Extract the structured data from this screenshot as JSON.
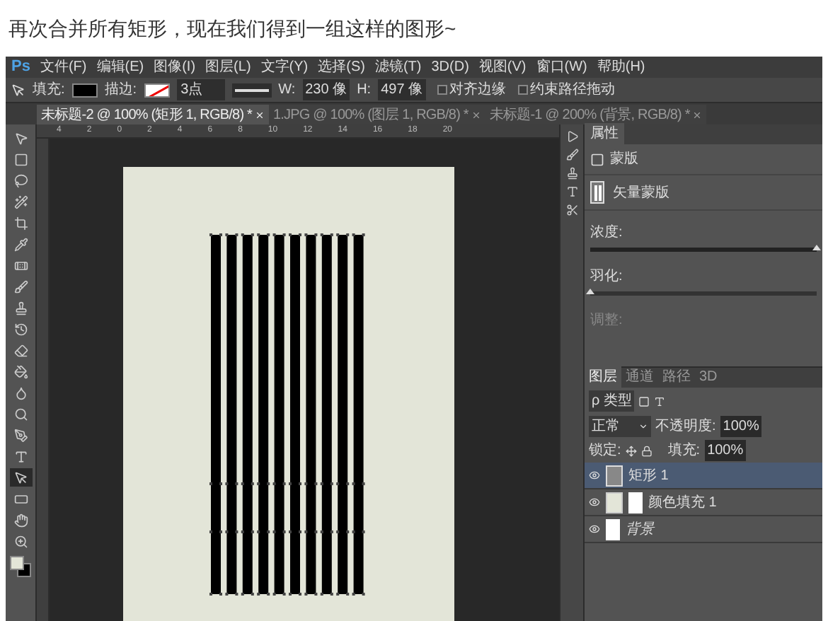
{
  "caption": "再次合并所有矩形，现在我们得到一组这样的图形~",
  "app": {
    "logo": "Ps",
    "menu": [
      "文件(F)",
      "编辑(E)",
      "图像(I)",
      "图层(L)",
      "文字(Y)",
      "选择(S)",
      "滤镜(T)",
      "3D(D)",
      "视图(V)",
      "窗口(W)",
      "帮助(H)"
    ],
    "options": {
      "fill_label": "填充:",
      "stroke_label": "描边:",
      "stroke_width": "3点",
      "w_label": "W:",
      "w_value": "230 像",
      "h_label": "H:",
      "h_value": "497 像",
      "checks": [
        {
          "label": "对齐边缘",
          "checked": false
        },
        {
          "label": "约束路径拖动",
          "checked": false
        }
      ]
    },
    "tabs": [
      {
        "label": "未标题-2 @ 100% (矩形 1, RGB/8) *",
        "selected": true
      },
      {
        "label": "1.JPG @ 100% (图层 1, RGB/8) *",
        "selected": false
      },
      {
        "label": "未标题-1 @ 200% (背景, RGB/8) *",
        "selected": false
      }
    ],
    "ruler_ticks": [
      "4",
      "2",
      "0",
      "2",
      "4",
      "6",
      "8",
      "10",
      "12",
      "14",
      "16",
      "18",
      "20"
    ],
    "tools": [
      {
        "selected": false
      },
      {
        "selected": false
      },
      {
        "selected": false
      },
      {
        "selected": false
      },
      {
        "selected": false
      },
      {
        "selected": false
      },
      {
        "selected": false
      },
      {
        "selected": false
      },
      {
        "selected": false
      },
      {
        "selected": false
      },
      {
        "selected": false
      },
      {
        "selected": false
      },
      {
        "selected": false
      },
      {
        "selected": false
      },
      {
        "selected": false
      },
      {
        "selected": false
      },
      {
        "selected": true
      },
      {
        "selected": false
      },
      {
        "selected": false
      },
      {
        "selected": false
      }
    ],
    "properties": {
      "tab": "属性",
      "mask_label": "蒙版",
      "vector_mask": "矢量蒙版",
      "density": "浓度:",
      "density_slider": {
        "level": 1
      },
      "feather": "羽化:",
      "feather_slider": {
        "level": 0
      },
      "adjust": {
        "label": "调整:",
        "disabled": true
      }
    },
    "layers_panel": {
      "tabs": [
        {
          "label": "图层",
          "selected": true
        },
        {
          "label": "通道",
          "selected": false
        },
        {
          "label": "路径",
          "selected": false
        },
        {
          "label": "3D",
          "selected": false
        }
      ],
      "filter": "ρ 类型",
      "blend_mode": "正常",
      "opacity_label": "不透明度:",
      "opacity": "100%",
      "lock_label": "锁定:",
      "fill_label": "填充:",
      "fill": "100%",
      "layers": [
        {
          "name": "矩形 1",
          "kind": "shape",
          "selected": true
        },
        {
          "name": "颜色填充 1",
          "kind": "fill",
          "selected": false
        },
        {
          "name": "背景",
          "kind": "background",
          "selected": false
        }
      ]
    }
  }
}
